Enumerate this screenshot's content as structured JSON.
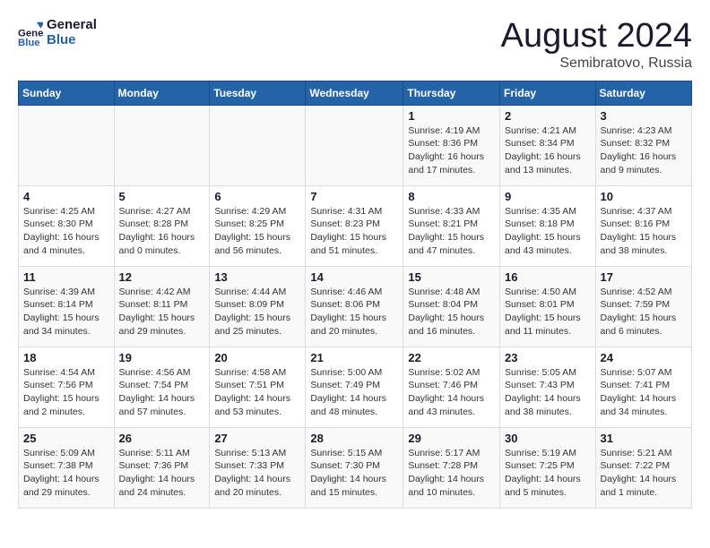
{
  "logo": {
    "line1": "General",
    "line2": "Blue"
  },
  "title": "August 2024",
  "subtitle": "Semibratovo, Russia",
  "days_of_week": [
    "Sunday",
    "Monday",
    "Tuesday",
    "Wednesday",
    "Thursday",
    "Friday",
    "Saturday"
  ],
  "weeks": [
    [
      {
        "day": "",
        "info": ""
      },
      {
        "day": "",
        "info": ""
      },
      {
        "day": "",
        "info": ""
      },
      {
        "day": "",
        "info": ""
      },
      {
        "day": "1",
        "info": "Sunrise: 4:19 AM\nSunset: 8:36 PM\nDaylight: 16 hours and 17 minutes."
      },
      {
        "day": "2",
        "info": "Sunrise: 4:21 AM\nSunset: 8:34 PM\nDaylight: 16 hours and 13 minutes."
      },
      {
        "day": "3",
        "info": "Sunrise: 4:23 AM\nSunset: 8:32 PM\nDaylight: 16 hours and 9 minutes."
      }
    ],
    [
      {
        "day": "4",
        "info": "Sunrise: 4:25 AM\nSunset: 8:30 PM\nDaylight: 16 hours and 4 minutes."
      },
      {
        "day": "5",
        "info": "Sunrise: 4:27 AM\nSunset: 8:28 PM\nDaylight: 16 hours and 0 minutes."
      },
      {
        "day": "6",
        "info": "Sunrise: 4:29 AM\nSunset: 8:25 PM\nDaylight: 15 hours and 56 minutes."
      },
      {
        "day": "7",
        "info": "Sunrise: 4:31 AM\nSunset: 8:23 PM\nDaylight: 15 hours and 51 minutes."
      },
      {
        "day": "8",
        "info": "Sunrise: 4:33 AM\nSunset: 8:21 PM\nDaylight: 15 hours and 47 minutes."
      },
      {
        "day": "9",
        "info": "Sunrise: 4:35 AM\nSunset: 8:18 PM\nDaylight: 15 hours and 43 minutes."
      },
      {
        "day": "10",
        "info": "Sunrise: 4:37 AM\nSunset: 8:16 PM\nDaylight: 15 hours and 38 minutes."
      }
    ],
    [
      {
        "day": "11",
        "info": "Sunrise: 4:39 AM\nSunset: 8:14 PM\nDaylight: 15 hours and 34 minutes."
      },
      {
        "day": "12",
        "info": "Sunrise: 4:42 AM\nSunset: 8:11 PM\nDaylight: 15 hours and 29 minutes."
      },
      {
        "day": "13",
        "info": "Sunrise: 4:44 AM\nSunset: 8:09 PM\nDaylight: 15 hours and 25 minutes."
      },
      {
        "day": "14",
        "info": "Sunrise: 4:46 AM\nSunset: 8:06 PM\nDaylight: 15 hours and 20 minutes."
      },
      {
        "day": "15",
        "info": "Sunrise: 4:48 AM\nSunset: 8:04 PM\nDaylight: 15 hours and 16 minutes."
      },
      {
        "day": "16",
        "info": "Sunrise: 4:50 AM\nSunset: 8:01 PM\nDaylight: 15 hours and 11 minutes."
      },
      {
        "day": "17",
        "info": "Sunrise: 4:52 AM\nSunset: 7:59 PM\nDaylight: 15 hours and 6 minutes."
      }
    ],
    [
      {
        "day": "18",
        "info": "Sunrise: 4:54 AM\nSunset: 7:56 PM\nDaylight: 15 hours and 2 minutes."
      },
      {
        "day": "19",
        "info": "Sunrise: 4:56 AM\nSunset: 7:54 PM\nDaylight: 14 hours and 57 minutes."
      },
      {
        "day": "20",
        "info": "Sunrise: 4:58 AM\nSunset: 7:51 PM\nDaylight: 14 hours and 53 minutes."
      },
      {
        "day": "21",
        "info": "Sunrise: 5:00 AM\nSunset: 7:49 PM\nDaylight: 14 hours and 48 minutes."
      },
      {
        "day": "22",
        "info": "Sunrise: 5:02 AM\nSunset: 7:46 PM\nDaylight: 14 hours and 43 minutes."
      },
      {
        "day": "23",
        "info": "Sunrise: 5:05 AM\nSunset: 7:43 PM\nDaylight: 14 hours and 38 minutes."
      },
      {
        "day": "24",
        "info": "Sunrise: 5:07 AM\nSunset: 7:41 PM\nDaylight: 14 hours and 34 minutes."
      }
    ],
    [
      {
        "day": "25",
        "info": "Sunrise: 5:09 AM\nSunset: 7:38 PM\nDaylight: 14 hours and 29 minutes."
      },
      {
        "day": "26",
        "info": "Sunrise: 5:11 AM\nSunset: 7:36 PM\nDaylight: 14 hours and 24 minutes."
      },
      {
        "day": "27",
        "info": "Sunrise: 5:13 AM\nSunset: 7:33 PM\nDaylight: 14 hours and 20 minutes."
      },
      {
        "day": "28",
        "info": "Sunrise: 5:15 AM\nSunset: 7:30 PM\nDaylight: 14 hours and 15 minutes."
      },
      {
        "day": "29",
        "info": "Sunrise: 5:17 AM\nSunset: 7:28 PM\nDaylight: 14 hours and 10 minutes."
      },
      {
        "day": "30",
        "info": "Sunrise: 5:19 AM\nSunset: 7:25 PM\nDaylight: 14 hours and 5 minutes."
      },
      {
        "day": "31",
        "info": "Sunrise: 5:21 AM\nSunset: 7:22 PM\nDaylight: 14 hours and 1 minute."
      }
    ]
  ]
}
